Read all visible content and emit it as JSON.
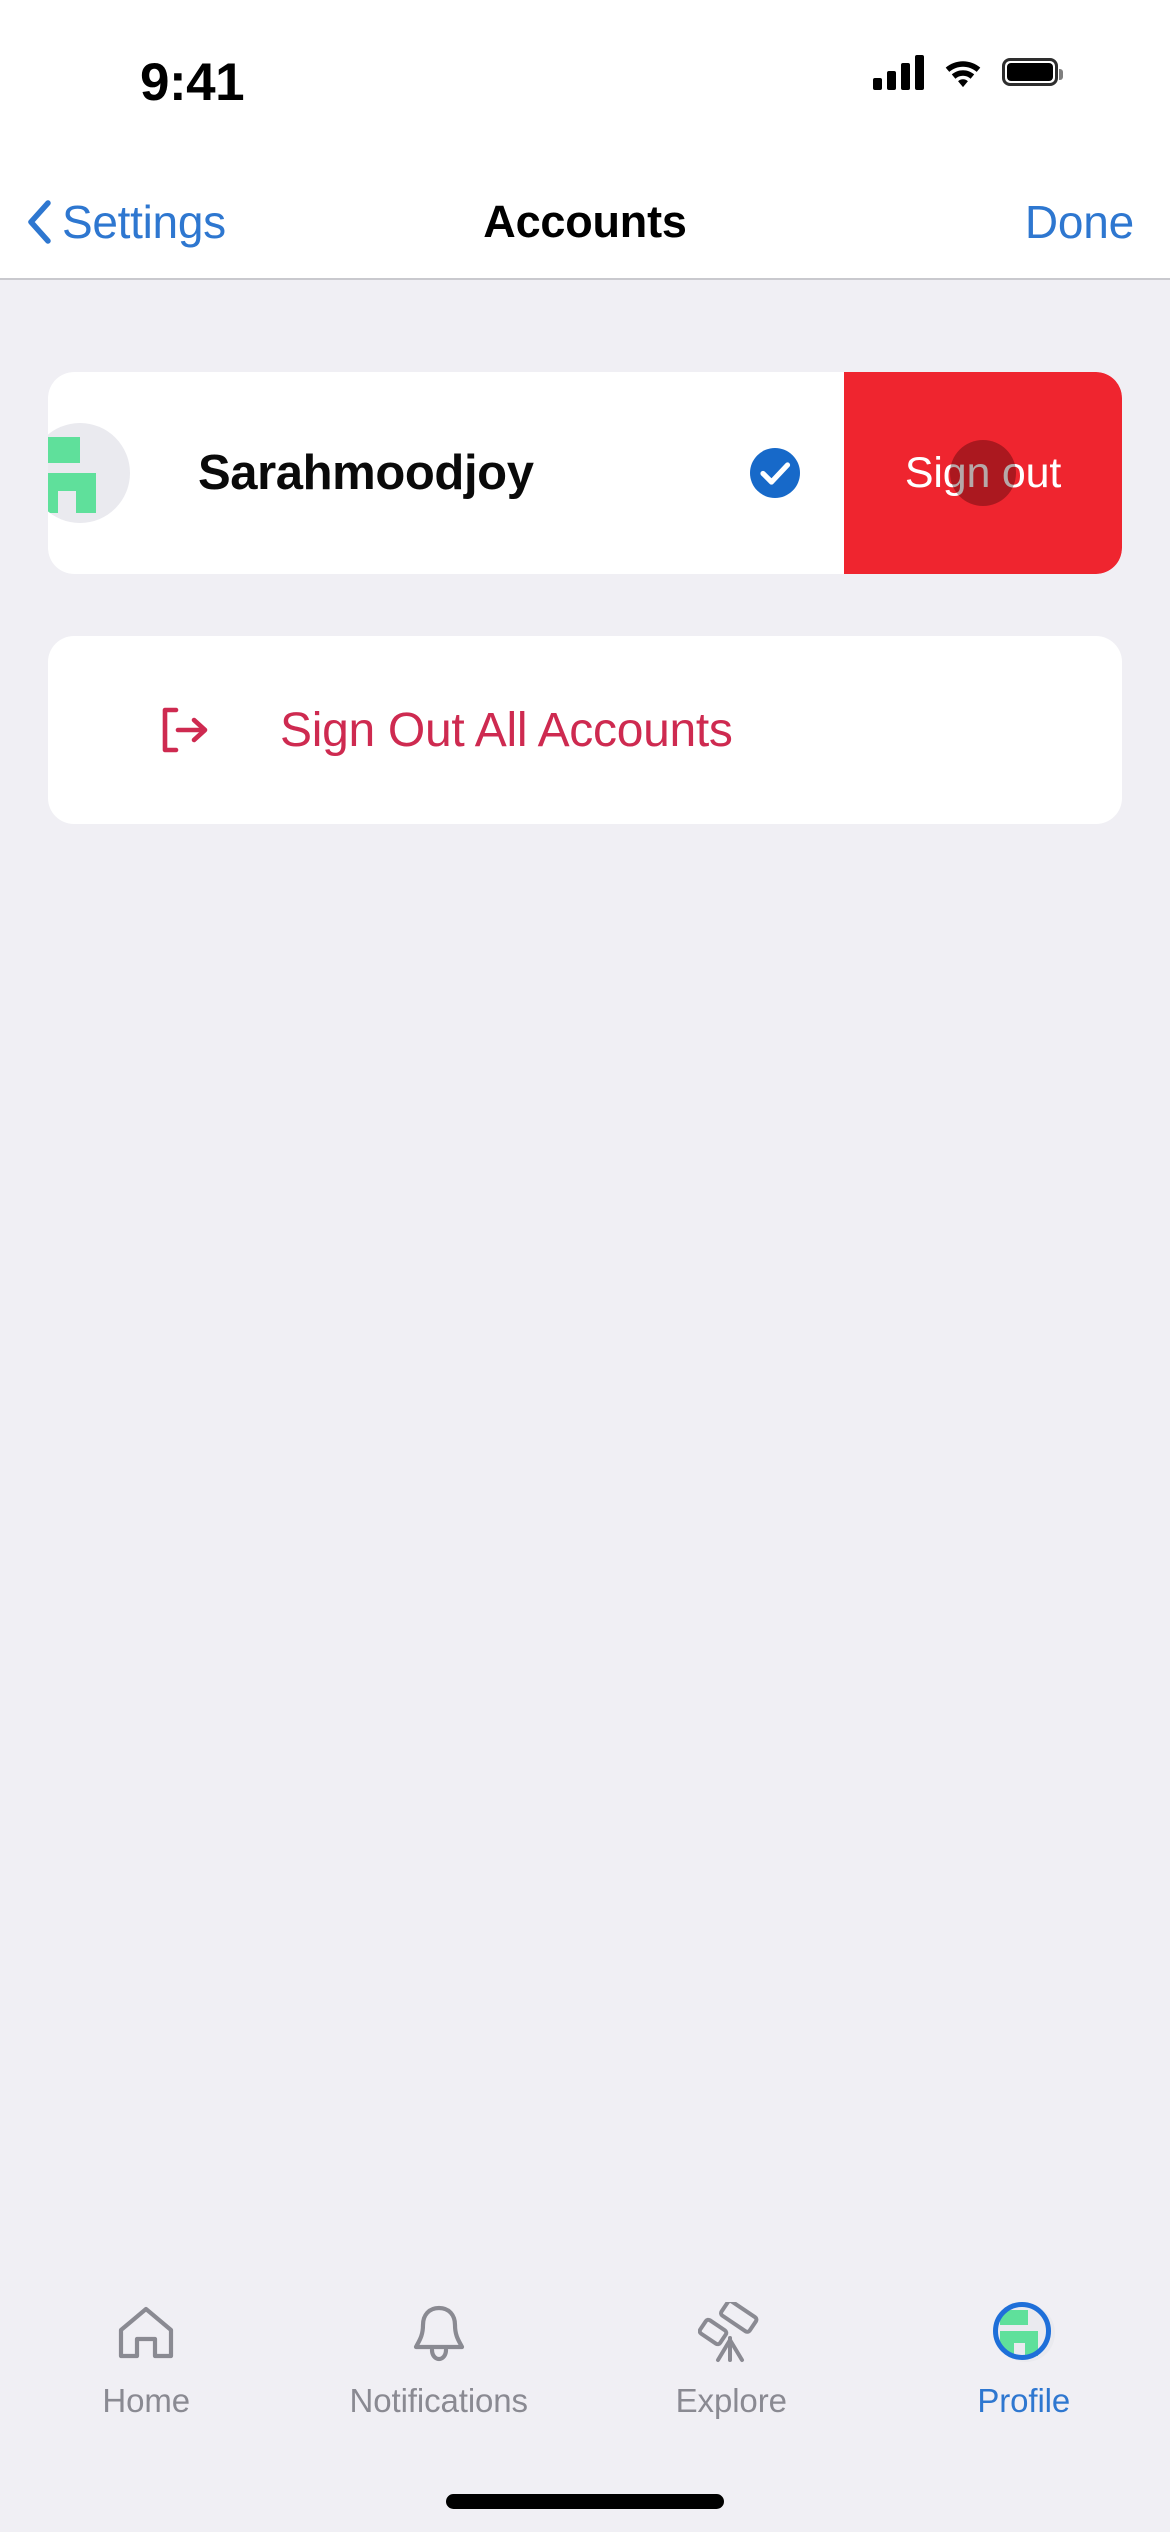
{
  "status_bar": {
    "time": "9:41",
    "cellular_icon": "signal-bars-icon",
    "wifi_icon": "wifi-icon",
    "battery_icon": "battery-full-icon"
  },
  "nav_bar": {
    "back_label": "Settings",
    "back_icon": "chevron-left-icon",
    "title": "Accounts",
    "done_label": "Done"
  },
  "accounts": {
    "row": {
      "name": "Sarahmoodjoy",
      "avatar_icon": "user-avatar",
      "verified_icon": "check-circle-icon",
      "swipe_action_label": "Sign out",
      "tap_indicator": "tap-indicator-circle"
    },
    "sign_out_all": {
      "label": "Sign Out All Accounts",
      "icon": "logout-icon"
    }
  },
  "tab_bar": {
    "tabs": [
      {
        "label": "Home",
        "icon": "home-icon",
        "active": false
      },
      {
        "label": "Notifications",
        "icon": "bell-icon",
        "active": false
      },
      {
        "label": "Explore",
        "icon": "telescope-icon",
        "active": false
      },
      {
        "label": "Profile",
        "icon": "profile-avatar-icon",
        "active": true
      }
    ]
  },
  "colors": {
    "accent_blue": "#2E77D0",
    "destructive_red": "#EF252F",
    "crimson": "#CE2A50",
    "avatar_green": "#5FE09B",
    "background": "#F0EFF4",
    "card": "#FFFFFF",
    "inactive_gray": "#8A8A92"
  }
}
